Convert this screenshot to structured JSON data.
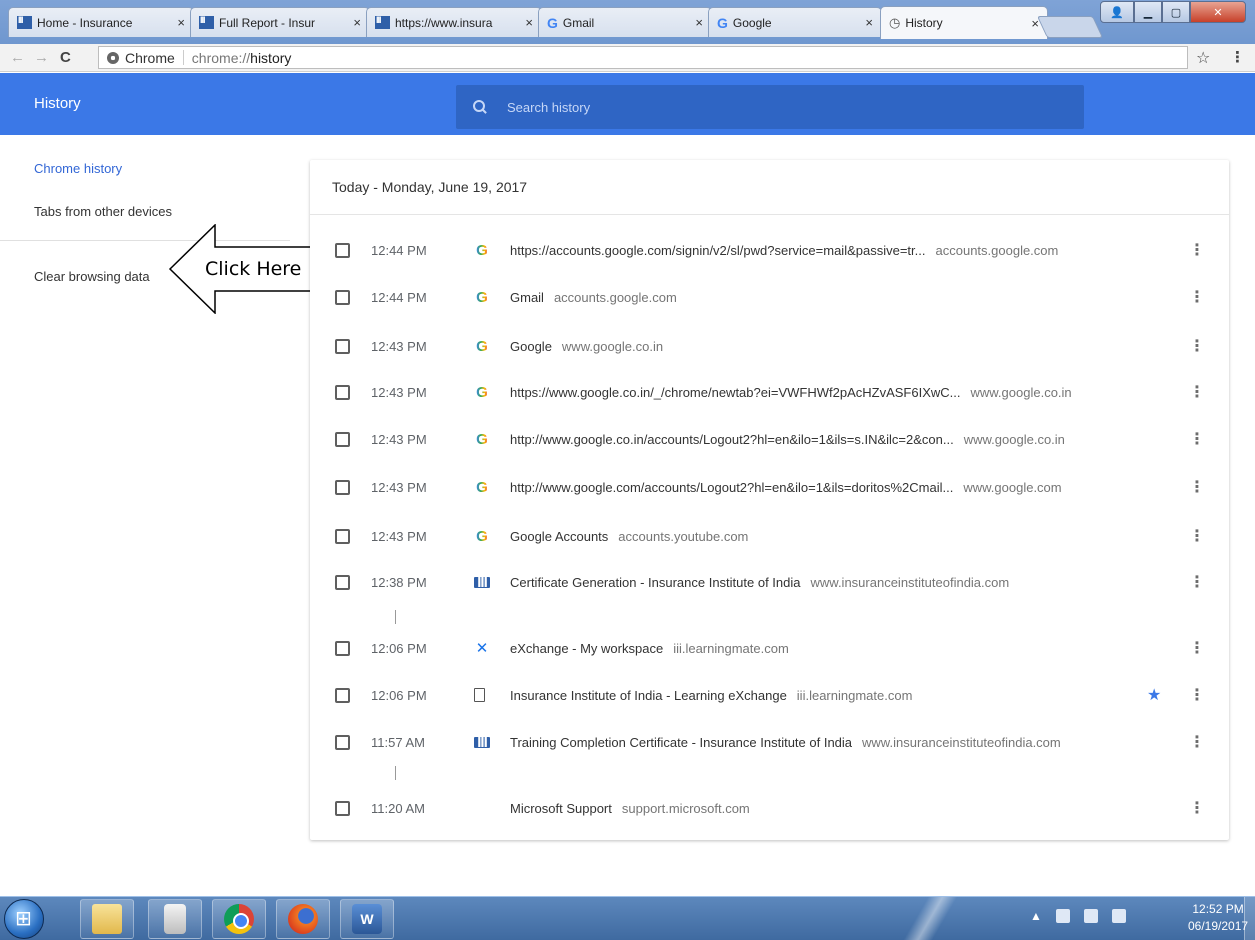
{
  "tabs": [
    {
      "label": "Home - Insurance",
      "favicon": "iii-icon",
      "close": "×"
    },
    {
      "label": "Full Report - Insur",
      "favicon": "iii-icon",
      "close": "×"
    },
    {
      "label": "https://www.insura",
      "favicon": "iii-icon",
      "close": "×"
    },
    {
      "label": "Gmail",
      "favicon": "google-icon",
      "close": "×"
    },
    {
      "label": "Google",
      "favicon": "google-icon",
      "close": "×"
    },
    {
      "label": "History",
      "favicon": "history-icon",
      "close": "×",
      "active": true
    }
  ],
  "omnibox": {
    "chip": "Chrome",
    "url_scheme": "chrome://",
    "url_host": "history"
  },
  "header": {
    "title": "History",
    "search_placeholder": "Search history"
  },
  "sidebar": {
    "items": [
      "Chrome history",
      "Tabs from other devices",
      "Clear browsing data"
    ]
  },
  "annotation": {
    "text": "Click Here"
  },
  "card": {
    "date_heading": "Today - Monday, June 19, 2017",
    "entries": [
      {
        "time": "12:44 PM",
        "favicon": "google-icon",
        "title": "https://accounts.google.com/signin/v2/sl/pwd?service=mail&passive=tr...",
        "domain": "accounts.google.com"
      },
      {
        "time": "12:44 PM",
        "favicon": "google-icon",
        "title": "Gmail",
        "domain": "accounts.google.com"
      },
      {
        "time": "12:43 PM",
        "favicon": "google-icon",
        "title": "Google",
        "domain": "www.google.co.in"
      },
      {
        "time": "12:43 PM",
        "favicon": "google-icon",
        "title": "https://www.google.co.in/_/chrome/newtab?ei=VWFHWf2pAcHZvASF6IXwC...",
        "domain": "www.google.co.in"
      },
      {
        "time": "12:43 PM",
        "favicon": "google-icon",
        "title": "http://www.google.co.in/accounts/Logout2?hl=en&ilo=1&ils=s.IN&ilc=2&con...",
        "domain": "www.google.co.in"
      },
      {
        "time": "12:43 PM",
        "favicon": "google-icon",
        "title": "http://www.google.com/accounts/Logout2?hl=en&ilo=1&ils=doritos%2Cmail...",
        "domain": "www.google.com"
      },
      {
        "time": "12:43 PM",
        "favicon": "google-icon",
        "title": "Google Accounts",
        "domain": "accounts.youtube.com"
      },
      {
        "time": "12:38 PM",
        "favicon": "iii-icon",
        "title": "Certificate Generation - Insurance Institute of India",
        "domain": "www.insuranceinstituteofindia.com"
      },
      {
        "time": "12:06 PM",
        "favicon": "exchange-icon",
        "title": "eXchange - My workspace",
        "domain": "iii.learningmate.com"
      },
      {
        "time": "12:06 PM",
        "favicon": "document-icon",
        "title": "Insurance Institute of India - Learning eXchange",
        "domain": "iii.learningmate.com",
        "bookmarked": true
      },
      {
        "time": "11:57 AM",
        "favicon": "iii-icon",
        "title": "Training Completion Certificate - Insurance Institute of India",
        "domain": "www.insuranceinstituteofindia.com"
      },
      {
        "time": "11:20 AM",
        "favicon": "microsoft-icon",
        "title": "Microsoft Support",
        "domain": "support.microsoft.com"
      }
    ]
  },
  "taskbar": {
    "apps": [
      "windows-start-icon",
      "explorer-icon",
      "calculator-icon",
      "chrome-icon",
      "firefox-icon",
      "word-icon"
    ],
    "clock_time": "12:52 PM",
    "clock_date": "06/19/2017"
  },
  "colors": {
    "accent": "#3b78e7",
    "header_search": "#2f65c4",
    "sidebar_active": "#3367d6"
  }
}
